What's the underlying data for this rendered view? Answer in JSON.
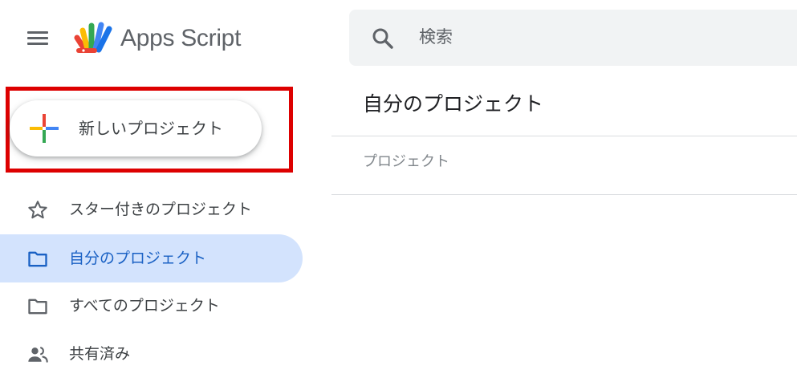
{
  "app": {
    "title": "Apps Script"
  },
  "search": {
    "placeholder": "検索"
  },
  "new_project": {
    "label": "新しいプロジェクト"
  },
  "sidebar": {
    "items": [
      {
        "label": "スター付きのプロジェクト",
        "icon": "star-icon",
        "active": false
      },
      {
        "label": "自分のプロジェクト",
        "icon": "folder-icon",
        "active": true
      },
      {
        "label": "すべてのプロジェクト",
        "icon": "folder-icon",
        "active": false
      },
      {
        "label": "共有済み",
        "icon": "people-icon",
        "active": false
      }
    ]
  },
  "main": {
    "heading": "自分のプロジェクト",
    "table": {
      "columns": [
        "プロジェクト"
      ]
    }
  },
  "colors": {
    "highlight_border": "#dd0000",
    "active_nav_bg": "#d3e3fd",
    "active_nav_text": "#1a61c4",
    "search_bg": "#f1f3f4"
  }
}
